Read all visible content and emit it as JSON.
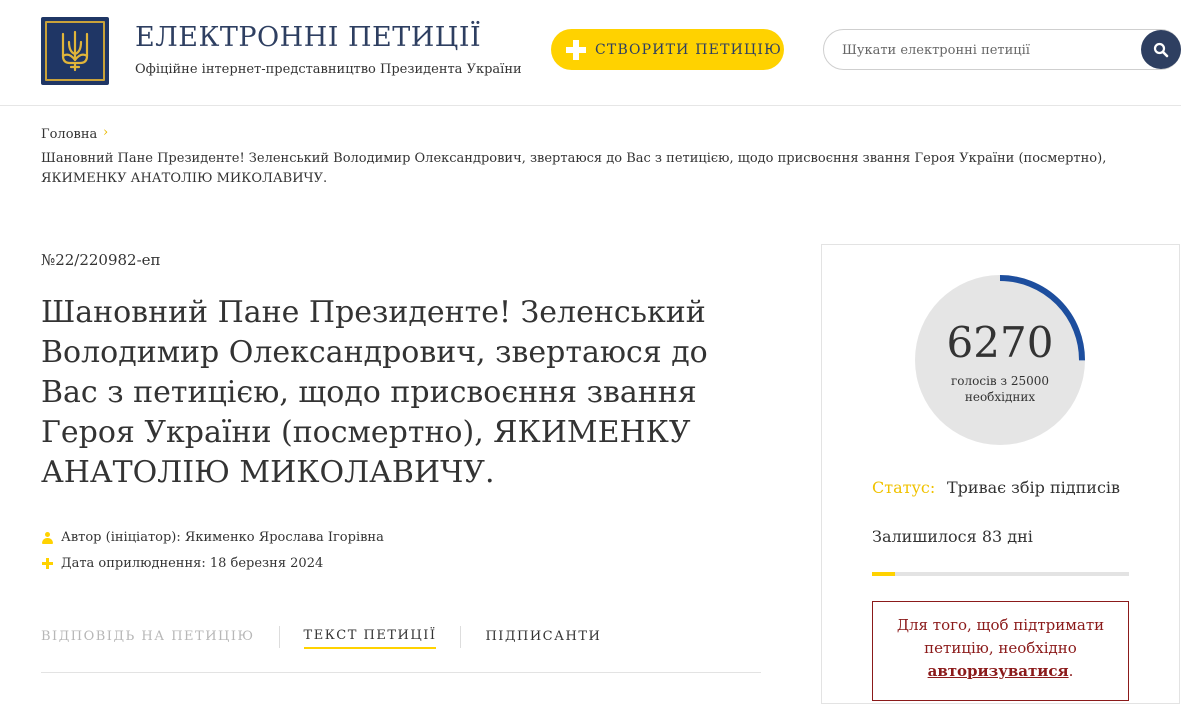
{
  "header": {
    "title": "ЕЛЕКТРОННІ ПЕТИЦІЇ",
    "subtitle": "Офіційне інтернет-представництво Президента України",
    "create_button": "СТВОРИТИ ПЕТИЦІЮ",
    "search_placeholder": "Шукати електронні петиції",
    "logo_icon": "trident-icon",
    "search_icon": "search-icon"
  },
  "breadcrumb": {
    "home": "Головна",
    "separator": "›",
    "current": "Шановний Пане Президенте! Зеленський Володимир Олександрович, звертаюся до Вас з петицією, щодо присвоєння звання Героя України (посмертно), ЯКИМЕНКУ АНАТОЛІЮ МИКОЛАВИЧУ."
  },
  "petition": {
    "number": "№22/220982-еп",
    "title": "Шановний Пане Президенте! Зеленський Володимир Олександрович, звертаюся до Вас з петицією, щодо присвоєння звання Героя України (посмертно), ЯКИМЕНКУ АНАТОЛІЮ МИКОЛАВИЧУ.",
    "author": "Автор (ініціатор): Якименко Ярослава Ігорівна",
    "date": "Дата оприлюднення: 18 березня 2024"
  },
  "tabs": [
    {
      "label": "ВІДПОВІДЬ НА ПЕТИЦІЮ",
      "state": "disabled"
    },
    {
      "label": "ТЕКСТ ПЕТИЦІЇ",
      "state": "active"
    },
    {
      "label": "ПІДПИСАНТИ",
      "state": "normal"
    }
  ],
  "sidebar": {
    "votes": 6270,
    "votes_caption": "голосів з 25000 необхідних",
    "votes_needed": 25000,
    "status_label": "Статус:",
    "status_value": "Триває збір підписів",
    "days_left": "Залишилося 83 дні",
    "days_progress": 0.09,
    "auth_text": "Для того, щоб підтримати петицію, необхідно",
    "auth_link": "авторизуватися",
    "auth_end": "."
  },
  "colors": {
    "accent_yellow": "#ffd200",
    "navy": "#2e3f61",
    "progress_blue": "#1d4e9e",
    "warning_red": "#8b1a1a"
  }
}
